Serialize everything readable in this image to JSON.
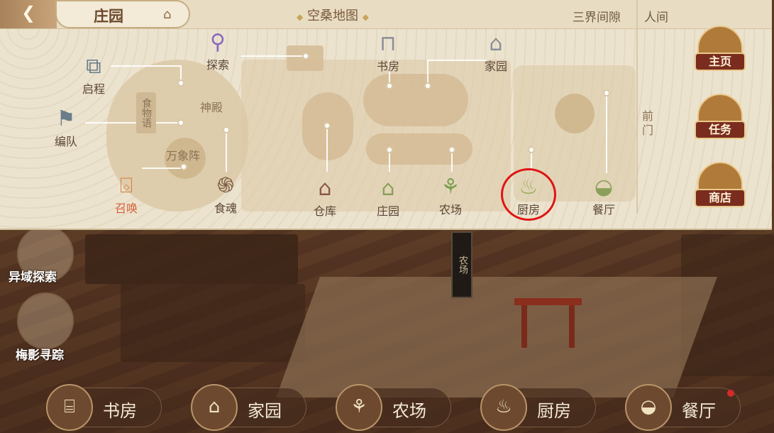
{
  "header": {
    "tab_label": "庄园",
    "map_title": "空桑地图",
    "links": [
      "三界间隙",
      "人间"
    ]
  },
  "map": {
    "nodes": {
      "qicheng": "启程",
      "tansuo": "探索",
      "bianbu": "编队",
      "zhaohuan": "召唤",
      "shihun": "食魂",
      "shufang": "书房",
      "jiayuan": "家园",
      "cangku": "仓库",
      "zhuangyuan": "庄园",
      "nongchang": "农场",
      "chufang": "厨房",
      "canting": "餐厅"
    },
    "areas": {
      "shendian": "神殿",
      "wanxiangzhen": "万象阵",
      "shiwuyu": "食物语",
      "qianmen": "前门"
    }
  },
  "side_buttons": {
    "home": "主页",
    "task": "任务",
    "shop": "商店"
  },
  "scene": {
    "farm_sign": "农场",
    "left_labels": [
      "异域探索",
      "梅影寻踪"
    ]
  },
  "dock": {
    "items": [
      "书房",
      "家园",
      "农场",
      "厨房",
      "餐厅"
    ]
  },
  "highlighted": "厨房"
}
